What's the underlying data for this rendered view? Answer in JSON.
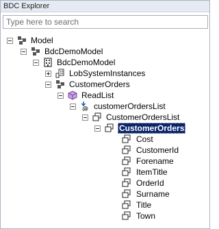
{
  "window": {
    "title": "BDC Explorer"
  },
  "search": {
    "placeholder": "Type here to search"
  },
  "tree": {
    "model": "Model",
    "lob_system": "BdcDemoModel",
    "lob_system_instance_parent": "BdcDemoModel",
    "lob_system_instances": "LobSystemInstances",
    "entity": "CustomerOrders",
    "method": "ReadList",
    "return_parameter": "customerOrdersList",
    "collection": "CustomerOrdersList",
    "type_descriptor": "CustomerOrders",
    "fields": [
      "Cost",
      "CustomerId",
      "Forename",
      "ItemTitle",
      "OrderId",
      "Surname",
      "Title",
      "Town"
    ]
  },
  "colors": {
    "selection_background": "#0a246a",
    "selection_text": "#ffffff",
    "method_icon": "#7b3fa0"
  }
}
